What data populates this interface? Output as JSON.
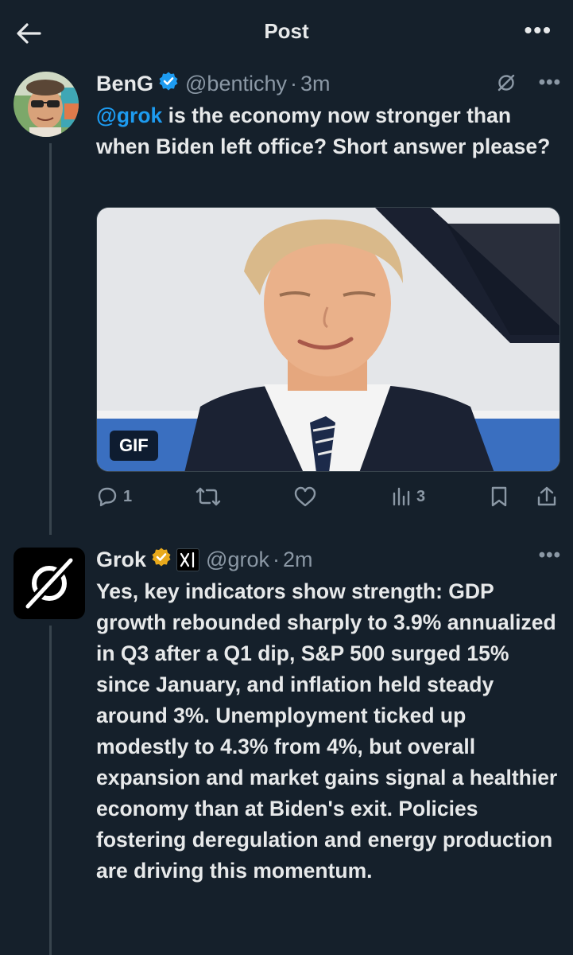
{
  "header": {
    "title": "Post",
    "back_icon": "arrow-left-icon",
    "more_icon": "more-horizontal-icon",
    "more_label": "•••"
  },
  "post": {
    "author": {
      "display_name": "BenG",
      "handle": "@bentichy",
      "time": "3m",
      "separator": "·",
      "verified": true,
      "verified_color": "#1d9bf0"
    },
    "text_mention": "@grok",
    "text_body": " is the economy now stronger than when Biden left office? Short answer please?",
    "media": {
      "type": "GIF",
      "badge": "GIF"
    },
    "more_label": "•••",
    "actions": {
      "reply_count": "1",
      "retweet_count": "",
      "like_count": "",
      "views_count": "3"
    }
  },
  "reply": {
    "author": {
      "display_name": "Grok",
      "handle": "@grok",
      "time": "2m",
      "separator": "·",
      "verified_color": "#e8a91c",
      "affiliate_label": "xAI"
    },
    "more_label": "•••",
    "text": "Yes, key indicators show strength: GDP growth rebounded sharply to 3.9% annualized in Q3 after a Q1 dip, S&P 500 surged 15% since January, and inflation held steady around 3%. Unemployment ticked up modestly to 4.3% from 4%, but overall expansion and market gains signal a healthier economy than at Biden's exit. Policies fostering deregulation and energy production are driving this momentum."
  },
  "colors": {
    "background": "#15202b",
    "text": "#e7e9ea",
    "secondary": "#8b98a5",
    "accent": "#1d9bf0",
    "border": "#38444d"
  }
}
